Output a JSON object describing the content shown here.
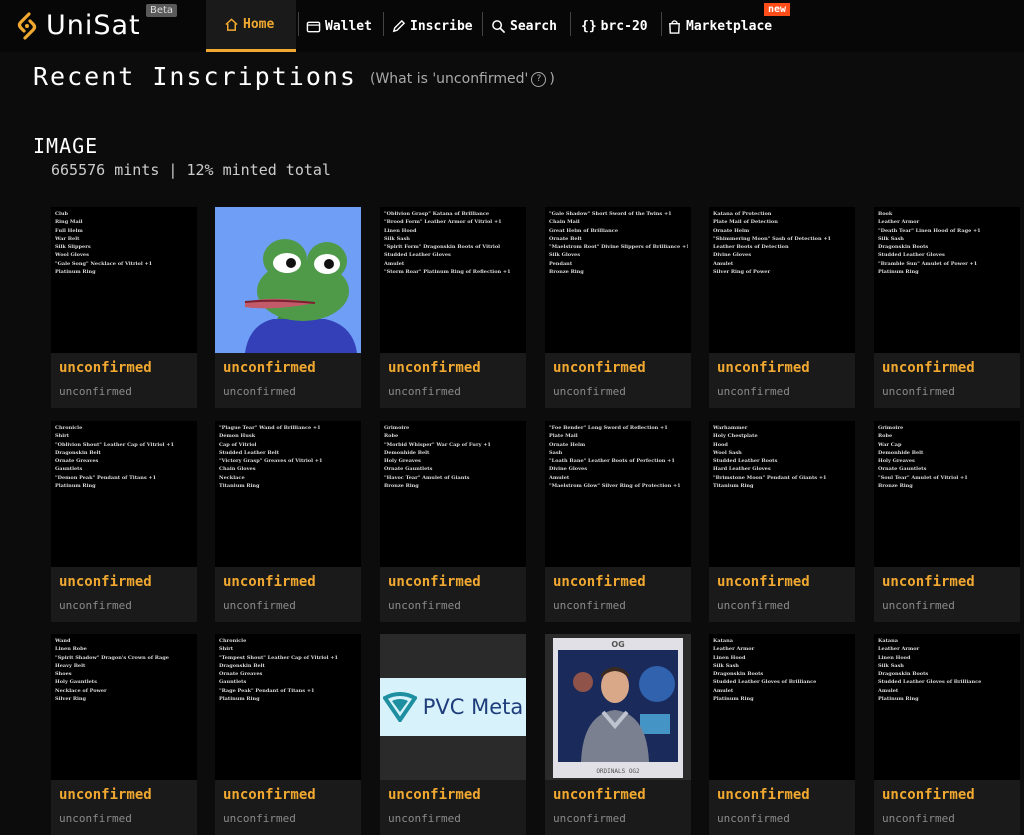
{
  "nav": {
    "brand": "UniSat",
    "beta": "Beta",
    "items": [
      {
        "label": "Home",
        "icon": "home-icon",
        "active": true
      },
      {
        "label": "Wallet",
        "icon": "wallet-icon"
      },
      {
        "label": "Inscribe",
        "icon": "pencil-icon"
      },
      {
        "label": "Search",
        "icon": "search-icon"
      },
      {
        "label": "brc-20",
        "icon": "braces-icon"
      },
      {
        "label": "Marketplace",
        "icon": "bag-icon"
      }
    ],
    "new_badge": "new"
  },
  "page": {
    "title": "Recent Inscriptions",
    "help_prefix": "(What is 'unconfirmed'",
    "help_q": "?",
    "help_suffix": ")"
  },
  "section": {
    "title": "IMAGE",
    "subtitle": "665576 mints | 12% minted total"
  },
  "colors": {
    "accent": "#f0a830",
    "new_badge": "#ff4d1a",
    "card_bg": "#1a1a1a"
  },
  "cards": [
    {
      "type": "text",
      "status": "unconfirmed",
      "sub": "unconfirmed",
      "lines": [
        "Club",
        "Ring Mail",
        "Full Helm",
        "War Belt",
        "Silk Slippers",
        "Wool Gloves",
        "\"Gale Song\" Necklace of Vitriol +1",
        "Platinum Ring"
      ]
    },
    {
      "type": "pepe",
      "status": "unconfirmed",
      "sub": "unconfirmed"
    },
    {
      "type": "text",
      "status": "unconfirmed",
      "sub": "unconfirmed",
      "lines": [
        "\"Oblivion Grasp\" Katana of Brilliance",
        "\"Brood Form\" Leather Armor of Vitriol +1",
        "Linen Hood",
        "Silk Sash",
        "\"Spirit Form\" Dragonskin Boots of Vitriol",
        "Studded Leather Gloves",
        "Amulet",
        "\"Storm Roar\" Platinum Ring of Reflection +1"
      ]
    },
    {
      "type": "text",
      "status": "unconfirmed",
      "sub": "unconfirmed",
      "lines": [
        "\"Gale Shadow\" Short Sword of the Twins +1",
        "Chain Mail",
        "Great Helm of Brilliance",
        "Ornate Belt",
        "\"Maelstrom Root\" Divine Slippers of Brilliance +1",
        "Silk Gloves",
        "Pendant",
        "Bronze Ring"
      ]
    },
    {
      "type": "text",
      "status": "unconfirmed",
      "sub": "unconfirmed",
      "lines": [
        "Katana of Protection",
        "Plate Mail of Detection",
        "Ornate Helm",
        "\"Shimmering Moon\" Sash of Detection +1",
        "Leather Boots of Detection",
        "Divine Gloves",
        "Amulet",
        "Silver Ring of Power"
      ]
    },
    {
      "type": "text",
      "status": "unconfirmed",
      "sub": "unconfirmed",
      "lines": [
        "Book",
        "Leather Armor",
        "\"Death Tear\" Linen Hood of Rage +1",
        "Silk Sash",
        "Dragonskin Boots",
        "Studded Leather Gloves",
        "\"Bramble Sun\" Amulet of Power +1",
        "Platinum Ring"
      ]
    },
    {
      "type": "text",
      "status": "unconfirmed",
      "sub": "unconfirmed",
      "lines": [
        "Chronicle",
        "Shirt",
        "\"Oblivion Shout\" Leather Cap of Vitriol +1",
        "Dragonskin Belt",
        "Ornate Greaves",
        "Gauntlets",
        "\"Demon Peak\" Pendant of Titans +1",
        "Platinum Ring"
      ]
    },
    {
      "type": "text",
      "status": "unconfirmed",
      "sub": "unconfirmed",
      "lines": [
        "\"Plague Tear\" Wand of Brilliance +1",
        "Demon Husk",
        "Cap of Vitriol",
        "Studded Leather Belt",
        "\"Victory Grasp\" Greaves of Vitriol +1",
        "Chain Gloves",
        "Necklace",
        "Titanium Ring"
      ]
    },
    {
      "type": "text",
      "status": "unconfirmed",
      "sub": "unconfirmed",
      "lines": [
        "Grimoire",
        "Robe",
        "\"Morbid Whisper\" War Cap of Fury +1",
        "Demonhide Belt",
        "Holy Greaves",
        "Ornate Gauntlets",
        "\"Havoc Tear\" Amulet of Giants",
        "Bronze Ring"
      ]
    },
    {
      "type": "text",
      "status": "unconfirmed",
      "sub": "unconfirmed",
      "lines": [
        "\"Foe Bender\" Long Sword of Reflection +1",
        "Plate Mail",
        "Ornate Helm",
        "Sash",
        "\"Loath Bane\" Leather Boots of Perfection +1",
        "Divine Gloves",
        "Amulet",
        "\"Maelstrom Glow\" Silver Ring of Protection +1"
      ]
    },
    {
      "type": "text",
      "status": "unconfirmed",
      "sub": "unconfirmed",
      "lines": [
        "Warhammer",
        "Holy Chestplate",
        "Hood",
        "Wool Sash",
        "Studded Leather Boots",
        "Hard Leather Gloves",
        "\"Brimstone Moon\" Pendant of Giants +1",
        "Titanium Ring"
      ]
    },
    {
      "type": "text",
      "status": "unconfirmed",
      "sub": "unconfirmed",
      "lines": [
        "Grimoire",
        "Robe",
        "War Cap",
        "Demonhide Belt",
        "Holy Greaves",
        "Ornate Gauntlets",
        "\"Soul Tear\" Amulet of Vitriol +1",
        "Bronze Ring"
      ]
    },
    {
      "type": "text",
      "status": "unconfirmed",
      "sub": "unconfirmed",
      "lines": [
        "Wand",
        "Linen Robe",
        "\"Spirit Shadow\" Dragon's Crown of Rage",
        "Heavy Belt",
        "Shoes",
        "Holy Gauntlets",
        "Necklace of Power",
        "Silver Ring"
      ]
    },
    {
      "type": "text",
      "status": "unconfirmed",
      "sub": "unconfirmed",
      "lines": [
        "Chronicle",
        "Shirt",
        "\"Tempest Shout\" Leather Cap of Vitriol +1",
        "Dragonskin Belt",
        "Ornate Greaves",
        "Gauntlets",
        "\"Rage Peak\" Pendant of Titans +1",
        "Platinum Ring"
      ]
    },
    {
      "type": "pvc",
      "status": "unconfirmed",
      "sub": "unconfirmed",
      "pvc_label": "PVC Meta"
    },
    {
      "type": "ordinal",
      "status": "unconfirmed",
      "sub": "unconfirmed",
      "card_top": "OG",
      "card_bottom": "ORDINALS OG2"
    },
    {
      "type": "text",
      "status": "unconfirmed",
      "sub": "unconfirmed",
      "lines": [
        "Katana",
        "Leather Armor",
        "Linen Hood",
        "Silk Sash",
        "Dragonskin Boots",
        "Studded Leather Gloves of Brilliance",
        "Amulet",
        "Platinum Ring"
      ]
    },
    {
      "type": "text",
      "status": "unconfirmed",
      "sub": "unconfirmed",
      "lines": [
        "Katana",
        "Leather Armor",
        "Linen Hood",
        "Silk Sash",
        "Dragonskin Boots",
        "Studded Leather Gloves of Brilliance",
        "Amulet",
        "Platinum Ring"
      ]
    }
  ]
}
